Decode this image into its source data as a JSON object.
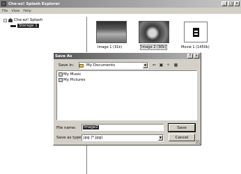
{
  "window": {
    "title": "Che-ez! Splash Explorer",
    "controls": [
      "_",
      "□",
      "x"
    ]
  },
  "menubar": [
    "File",
    "View",
    "Help"
  ],
  "tree": {
    "root": "Che-ez! Splash",
    "root_expander": "-",
    "child": "Storage 1"
  },
  "thumbnails": [
    {
      "caption": "Image 1 (31k)"
    },
    {
      "caption": "Image 2 (30k)"
    },
    {
      "caption": "Movie 1 (1450k)"
    }
  ],
  "dialog": {
    "title": "Save As",
    "controls": [
      "?",
      "x"
    ],
    "save_in_label": "Save in:",
    "save_in_value": "My Documents",
    "files": [
      "My Music",
      "My Pictures"
    ],
    "file_name_label": "File name:",
    "file_name_value": "Image2",
    "save_type_label": "Save as type:",
    "save_type_value": "jpg (*.jpg)",
    "save_button": "Save",
    "cancel_button": "Cancel"
  }
}
